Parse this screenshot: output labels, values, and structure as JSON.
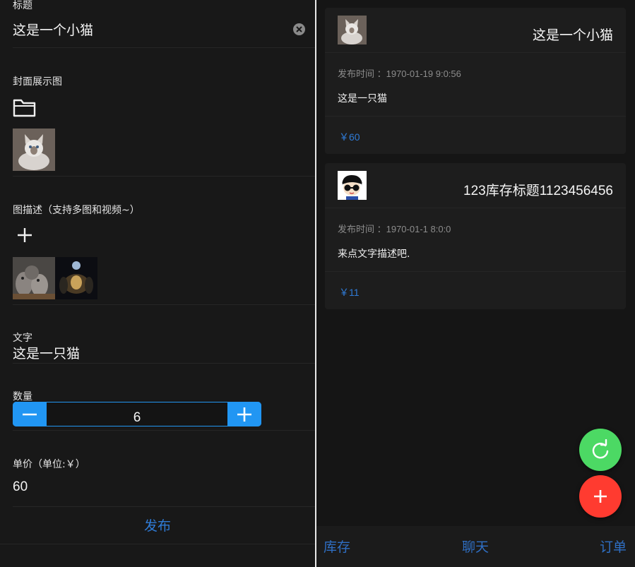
{
  "form": {
    "title_label": "标题",
    "title_value": "这是一个小猫",
    "cover_label": "封面展示图",
    "gallery_label": "图描述（支持多图和视频~）",
    "text_label": "文字",
    "text_value": "这是一只猫",
    "quantity_label": "数量",
    "quantity_value": "6",
    "price_label": "单价（单位:￥）",
    "price_value": "60",
    "publish_label": "发布"
  },
  "cards": [
    {
      "title": "这是一个小猫",
      "time": "发布时间 ：1970-01-19 9:0:56",
      "desc": "这是一只猫",
      "price": "￥60"
    },
    {
      "title": "123库存标题1123456456",
      "time": "发布时间 ：1970-01-1 8:0:0",
      "desc": "来点文字描述吧.",
      "price": "￥11"
    }
  ],
  "tabbar": {
    "tabs": [
      "库存",
      "聊天",
      "订单"
    ]
  },
  "colors": {
    "accent": "#2196f3",
    "link": "#2f7bd6",
    "fab_refresh": "#4cd964",
    "fab_add": "#ff3b30"
  },
  "icons": [
    "clear-icon",
    "folder-icon",
    "plus-icon",
    "minus-icon",
    "refresh-icon",
    "add-icon"
  ]
}
